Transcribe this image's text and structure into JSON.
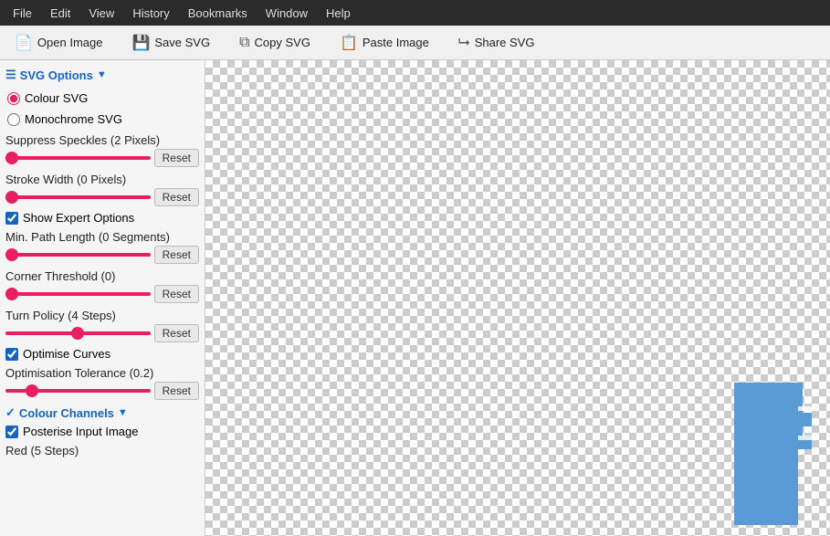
{
  "menubar": {
    "items": [
      "File",
      "Edit",
      "View",
      "History",
      "Bookmarks",
      "Window",
      "Help"
    ]
  },
  "toolbar": {
    "open_image": "Open Image",
    "save_svg": "Save SVG",
    "copy_svg": "Copy SVG",
    "paste_image": "Paste Image",
    "share_svg": "Share SVG"
  },
  "sidebar": {
    "svg_options_label": "SVG Options",
    "colour_svg_label": "Colour SVG",
    "monochrome_svg_label": "Monochrome SVG",
    "suppress_speckles_label": "Suppress Speckles (2 Pixels)",
    "stroke_width_label": "Stroke Width (0 Pixels)",
    "show_expert_label": "Show Expert Options",
    "min_path_label": "Min. Path Length (0 Segments)",
    "corner_threshold_label": "Corner Threshold (0)",
    "turn_policy_label": "Turn Policy (4 Steps)",
    "optimise_curves_label": "Optimise Curves",
    "optimisation_tolerance_label": "Optimisation Tolerance (0.2)",
    "colour_channels_label": "Colour Channels",
    "posterise_label": "Posterise Input Image",
    "red_label": "Red (5 Steps)",
    "suppress_slider": 0,
    "stroke_slider": 0,
    "min_path_slider": 0,
    "corner_threshold_slider": 0,
    "turn_policy_slider": 50,
    "optimisation_tolerance_slider": 15
  }
}
